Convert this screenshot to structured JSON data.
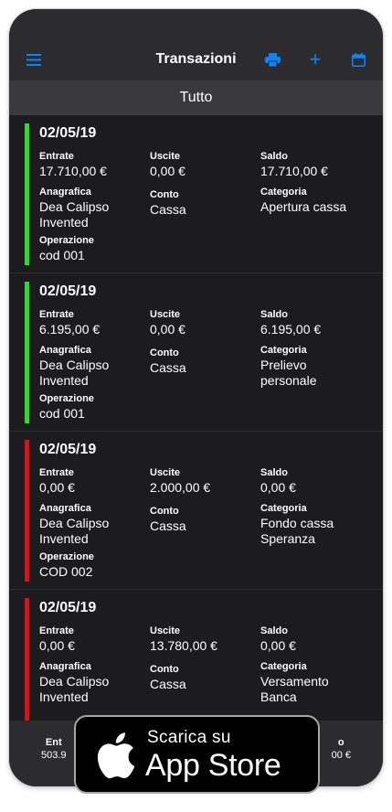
{
  "navbar": {
    "title": "Transazioni",
    "menu_icon": "hamburger-menu-icon",
    "print_icon": "printer-icon",
    "add_label": "+",
    "calendar_icon": "calendar-icon"
  },
  "filter": {
    "label": "Tutto"
  },
  "labels": {
    "entrate": "Entrate",
    "uscite": "Uscite",
    "saldo": "Saldo",
    "anagrafica": "Anagrafica",
    "conto": "Conto",
    "categoria": "Categoria",
    "operazione": "Operazione"
  },
  "transactions": [
    {
      "date": "02/05/19",
      "type": "positive",
      "entrate": "17.710,00 €",
      "uscite": "0,00 €",
      "saldo": "17.710,00 €",
      "anagrafica": [
        "Dea Calipso",
        "Invented"
      ],
      "conto": "Cassa",
      "categoria": [
        "Apertura cassa"
      ],
      "operazione": "cod 001"
    },
    {
      "date": "02/05/19",
      "type": "positive",
      "entrate": "6.195,00 €",
      "uscite": "0,00 €",
      "saldo": "6.195,00 €",
      "anagrafica": [
        "Dea Calipso",
        "Invented"
      ],
      "conto": "Cassa",
      "categoria": [
        "Prelievo",
        "personale"
      ],
      "operazione": "cod 001"
    },
    {
      "date": "02/05/19",
      "type": "negative",
      "entrate": "0,00 €",
      "uscite": "2.000,00 €",
      "saldo": "0,00 €",
      "anagrafica": [
        "Dea Calipso",
        "Invented"
      ],
      "conto": "Cassa",
      "categoria": [
        "Fondo cassa",
        "Speranza"
      ],
      "operazione": "COD 002"
    },
    {
      "date": "02/05/19",
      "type": "negative",
      "entrate": "0,00 €",
      "uscite": "13.780,00 €",
      "saldo": "0,00 €",
      "anagrafica": [
        "Dea Calipso",
        "Invented"
      ],
      "conto": "Cassa",
      "categoria": [
        "Versamento",
        "Banca"
      ],
      "operazione": ""
    }
  ],
  "footer": {
    "left_label": "Ent",
    "left_value": "503.9",
    "right_label": "o",
    "right_value": "00 €"
  },
  "app_store_badge": {
    "line1": "Scarica su",
    "line2": "App Store",
    "icon": "apple-logo-icon"
  },
  "colors": {
    "positive": "#22e12a",
    "negative": "#d8111b",
    "accent": "#0a84ff"
  }
}
